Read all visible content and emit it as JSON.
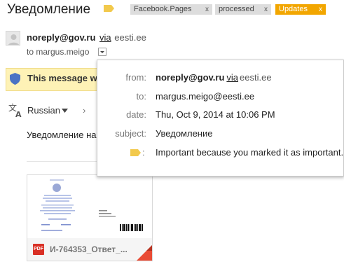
{
  "header": {
    "subject": "Уведомление",
    "labels": [
      {
        "name": "Facebook.Pages",
        "remove": "x"
      },
      {
        "name": "processed",
        "remove": "x"
      },
      {
        "name": "Updates",
        "remove": "x"
      }
    ]
  },
  "sender": {
    "email": "noreply@gov.ru",
    "via": "via",
    "via_domain": "eesti.ee",
    "to_line": "to margus.meigo"
  },
  "warning": {
    "text": "This message w"
  },
  "translate": {
    "language": "Russian",
    "arrow": "›"
  },
  "body": {
    "text": "Уведомление на"
  },
  "attachment": {
    "name": "И-764353_Ответ_...",
    "type": "PDF"
  },
  "details": {
    "from_label": "from:",
    "from_email": "noreply@gov.ru",
    "from_via": "via",
    "from_domain": "eesti.ee",
    "to_label": "to:",
    "to_value": "margus.meigo@eesti.ee",
    "date_label": "date:",
    "date_value": "Thu, Oct 9, 2014 at 10:06 PM",
    "subject_label": "subject:",
    "subject_value": "Уведомление",
    "importance_colon": ":",
    "importance_value": "Important because you marked it as important."
  },
  "colors": {
    "importance_marker": "#f2c94c",
    "updates_label": "#f2a600",
    "warning_bg": "#fef2b6",
    "shield": "#4a72c4",
    "pdf": "#d93025"
  }
}
